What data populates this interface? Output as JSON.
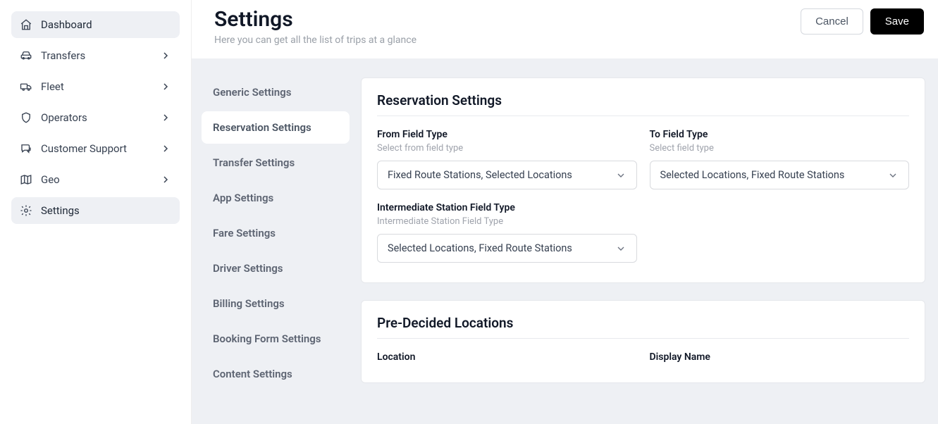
{
  "header": {
    "title": "Settings",
    "subtitle": "Here you can get all the list of trips at a glance",
    "cancel": "Cancel",
    "save": "Save"
  },
  "sidebar": {
    "items": [
      {
        "label": "Dashboard"
      },
      {
        "label": "Transfers"
      },
      {
        "label": "Fleet"
      },
      {
        "label": "Operators"
      },
      {
        "label": "Customer Support"
      },
      {
        "label": "Geo"
      },
      {
        "label": "Settings"
      }
    ]
  },
  "subnav": {
    "items": [
      {
        "label": "Generic Settings"
      },
      {
        "label": "Reservation Settings"
      },
      {
        "label": "Transfer Settings"
      },
      {
        "label": "App Settings"
      },
      {
        "label": "Fare Settings"
      },
      {
        "label": "Driver Settings"
      },
      {
        "label": "Billing Settings"
      },
      {
        "label": "Booking Form Settings"
      },
      {
        "label": "Content Settings"
      }
    ]
  },
  "card1": {
    "title": "Reservation Settings",
    "from": {
      "label": "From Field Type",
      "help": "Select from field type",
      "value": "Fixed Route Stations, Selected Locations"
    },
    "to": {
      "label": "To Field Type",
      "help": "Select field type",
      "value": "Selected Locations, Fixed Route Stations"
    },
    "intermediate": {
      "label": "Intermediate Station Field Type",
      "help": "Intermediate Station Field Type",
      "value": "Selected Locations, Fixed Route Stations"
    }
  },
  "card2": {
    "title": "Pre-Decided Locations",
    "col1": "Location",
    "col2": "Display Name"
  }
}
